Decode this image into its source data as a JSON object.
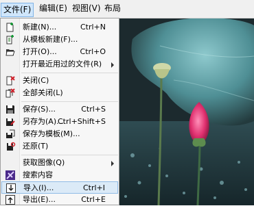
{
  "menubar": {
    "items": [
      {
        "label": "文件(F)"
      },
      {
        "label": "编辑(E)"
      },
      {
        "label": "视图(V)"
      },
      {
        "label": "布局"
      }
    ]
  },
  "file_menu": {
    "items": [
      {
        "label": "新建(N)...",
        "shortcut": "Ctrl+N",
        "icon": "new-document-icon"
      },
      {
        "label": "从模板新建(F)...",
        "shortcut": "",
        "icon": "new-from-template-icon"
      },
      {
        "label": "打开(O)...",
        "shortcut": "Ctrl+O",
        "icon": "open-folder-icon"
      },
      {
        "label": "打开最近用过的文件(R)",
        "shortcut": "",
        "icon": "",
        "submenu": true
      },
      {
        "label": "关闭(C)",
        "shortcut": "",
        "icon": "close-document-icon"
      },
      {
        "label": "全部关闭(L)",
        "shortcut": "",
        "icon": "close-all-icon"
      },
      {
        "label": "保存(S)...",
        "shortcut": "Ctrl+S",
        "icon": "save-icon"
      },
      {
        "label": "另存为(A)...",
        "shortcut": "Ctrl+Shift+S",
        "icon": "save-as-icon"
      },
      {
        "label": "保存为模板(M)...",
        "shortcut": "",
        "icon": "save-as-template-icon"
      },
      {
        "label": "还原(T)",
        "shortcut": "",
        "icon": "revert-icon"
      },
      {
        "label": "获取图像(Q)",
        "shortcut": "",
        "icon": "",
        "submenu": true
      },
      {
        "label": "搜索内容",
        "shortcut": "",
        "icon": "search-content-icon"
      },
      {
        "label": "导入(I)...",
        "shortcut": "Ctrl+I",
        "icon": "import-icon",
        "highlighted": true
      },
      {
        "label": "导出(E)...",
        "shortcut": "Ctrl+E",
        "icon": "export-icon"
      }
    ]
  },
  "colors": {
    "highlight_bg": "#dbeaf7",
    "highlight_border": "#8fbbe6",
    "menu_bg": "#f7f7f7"
  },
  "photo": {
    "subject": "lotus-bud-and-seedpod-photo"
  }
}
